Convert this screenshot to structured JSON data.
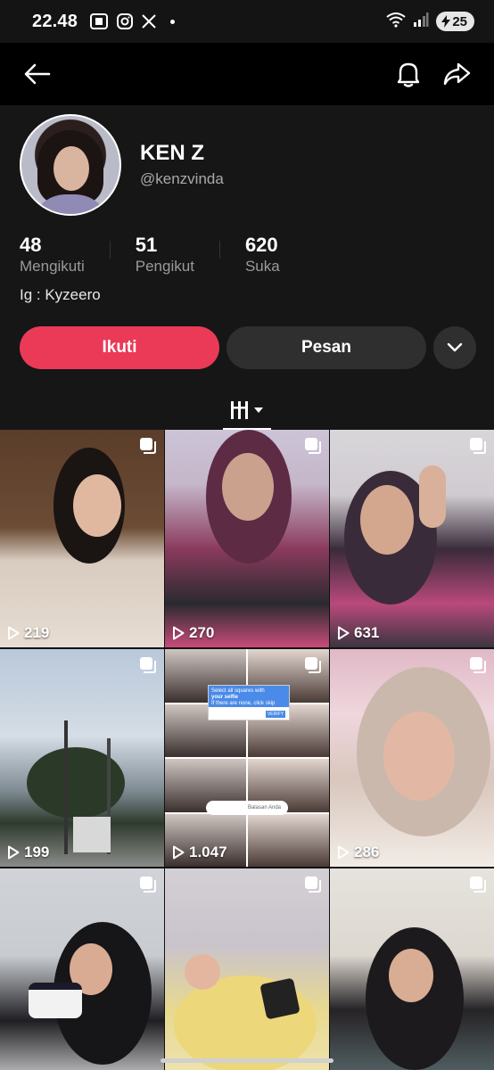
{
  "status_bar": {
    "time": "22.48",
    "battery": "25",
    "icons": [
      "screenshot-icon",
      "instagram-icon",
      "x-icon",
      "wifi-icon",
      "signal-icon",
      "battery-charging-icon"
    ]
  },
  "top_nav": {
    "icons": [
      "back-arrow-icon",
      "bell-icon",
      "share-icon"
    ]
  },
  "profile": {
    "name": "KEN Z",
    "handle": "@kenzvinda",
    "stats": [
      {
        "value": "48",
        "label": "Mengikuti"
      },
      {
        "value": "51",
        "label": "Pengikut"
      },
      {
        "value": "620",
        "label": "Suka"
      }
    ],
    "bio": "Ig : Kyzeero",
    "follow_label": "Ikuti",
    "message_label": "Pesan"
  },
  "colors": {
    "follow_button": "#ea3a57",
    "background": "#121212",
    "secondary_button": "#2f2f2f"
  },
  "videos": [
    {
      "views": "219"
    },
    {
      "views": "270"
    },
    {
      "views": "631"
    },
    {
      "views": "199"
    },
    {
      "views": "1.047",
      "overlay": {
        "captcha_text": "Select all squares with",
        "captcha_bold": "your selfie",
        "captcha_sub": "If there are none, click skip",
        "captcha_button": "VERIFY",
        "reply_text": "Balasan Anda"
      }
    },
    {
      "views": "286"
    },
    {
      "views": ""
    },
    {
      "views": ""
    },
    {
      "views": ""
    }
  ]
}
